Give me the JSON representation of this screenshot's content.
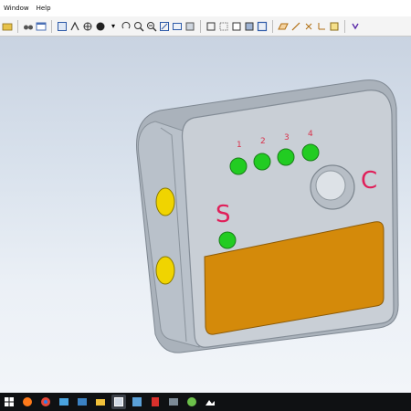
{
  "menu": [
    "Window",
    "Help"
  ],
  "colors": {
    "led_green": "#22cc22",
    "panel_orange": "#d48a0a",
    "button_yellow": "#f0d400",
    "label_red": "#e0205a",
    "body_gray": "#c6ccd3"
  },
  "model": {
    "led_numbers": [
      "1",
      "2",
      "3",
      "4"
    ],
    "label_s": "S",
    "label_c": "C"
  },
  "taskbar_icons": [
    "windows-start-icon",
    "file-explorer-icon",
    "chrome-icon",
    "app-icon",
    "app-icon-2",
    "mail-icon",
    "app-icon-3",
    "app-icon-4",
    "pdf-icon",
    "app-icon-5",
    "photo-icon"
  ]
}
